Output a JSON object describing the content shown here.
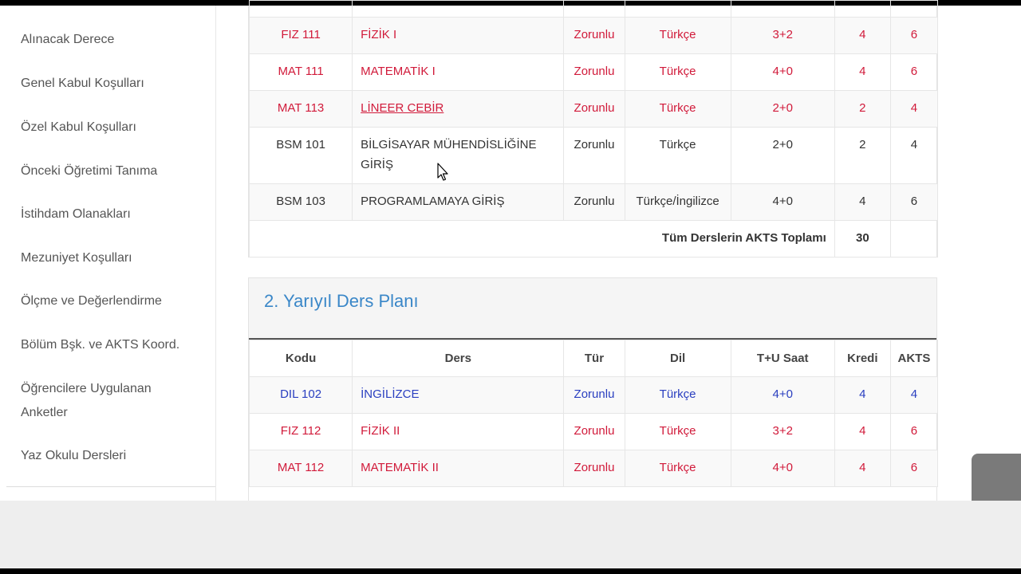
{
  "sidebar": {
    "items": [
      {
        "label": "Alınacak Derece"
      },
      {
        "label": "Genel Kabul Koşulları"
      },
      {
        "label": "Özel Kabul Koşulları"
      },
      {
        "label": "Önceki Öğretimi Tanıma"
      },
      {
        "label": "İstihdam Olanakları"
      },
      {
        "label": "Mezuniyet Koşulları"
      },
      {
        "label": "Ölçme ve Değerlendirme"
      },
      {
        "label": "Bölüm Bşk. ve AKTS Koord."
      },
      {
        "label": "Öğrencilere Uygulanan Anketler"
      },
      {
        "label": "Yaz Okulu Dersleri"
      }
    ]
  },
  "semester1": {
    "rows": [
      {
        "code": "FIZ 111",
        "name": "FİZİK I",
        "type": "Zorunlu",
        "lang": "Türkçe",
        "hours": "3+2",
        "credit": "4",
        "ects": "6"
      },
      {
        "code": "MAT 111",
        "name": "MATEMATİK I",
        "type": "Zorunlu",
        "lang": "Türkçe",
        "hours": "4+0",
        "credit": "4",
        "ects": "6"
      },
      {
        "code": "MAT 113",
        "name": "LİNEER CEBİR",
        "type": "Zorunlu",
        "lang": "Türkçe",
        "hours": "2+0",
        "credit": "2",
        "ects": "4"
      },
      {
        "code": "BSM 101",
        "name": "BİLGİSAYAR MÜHENDİSLİĞİNE GİRİŞ",
        "type": "Zorunlu",
        "lang": "Türkçe",
        "hours": "2+0",
        "credit": "2",
        "ects": "4"
      },
      {
        "code": "BSM 103",
        "name": "PROGRAMLAMAYA GİRİŞ",
        "type": "Zorunlu",
        "lang": "Türkçe/İngilizce",
        "hours": "4+0",
        "credit": "4",
        "ects": "6"
      }
    ],
    "total_label": "Tüm Derslerin AKTS Toplamı",
    "total_value": "30"
  },
  "semester2": {
    "title": "2. Yarıyıl Ders Planı",
    "headers": {
      "code": "Kodu",
      "name": "Ders",
      "type": "Tür",
      "lang": "Dil",
      "hours": "T+U Saat",
      "credit": "Kredi",
      "ects": "AKTS"
    },
    "rows": [
      {
        "code": "DIL 102",
        "name": "İNGİLİZCE",
        "type": "Zorunlu",
        "lang": "Türkçe",
        "hours": "4+0",
        "credit": "4",
        "ects": "4"
      },
      {
        "code": "FIZ 112",
        "name": "FİZİK II",
        "type": "Zorunlu",
        "lang": "Türkçe",
        "hours": "3+2",
        "credit": "4",
        "ects": "6"
      },
      {
        "code": "MAT 112",
        "name": "MATEMATİK II",
        "type": "Zorunlu",
        "lang": "Türkçe",
        "hours": "4+0",
        "credit": "4",
        "ects": "6"
      }
    ]
  },
  "colors": {
    "red": "#d11a3a",
    "blue": "#2a3fc0",
    "title_blue": "#3a87c8"
  },
  "icons": {
    "cursor": "mouse-pointer-icon"
  }
}
